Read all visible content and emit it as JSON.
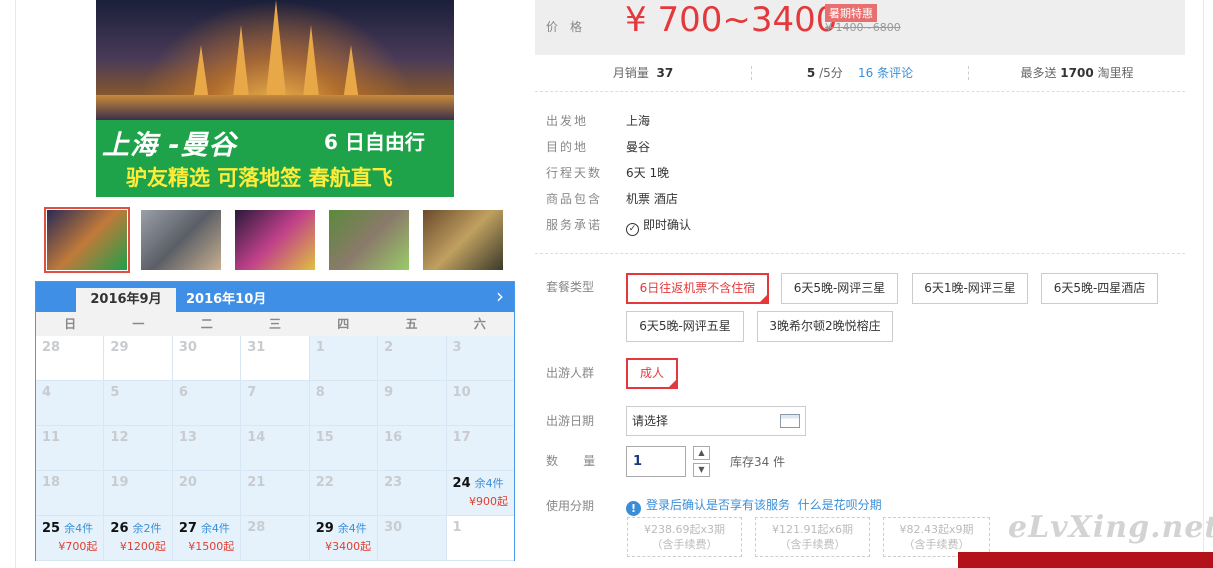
{
  "banner": {
    "title": "上海 -曼谷",
    "subtitle": "6 日自由行",
    "tagline": "驴友精选 可落地签 春航直飞"
  },
  "thumbnails": [
    {
      "name": "temple",
      "colors": [
        "#2a2a55",
        "#c07a3a",
        "#1f9f4a"
      ]
    },
    {
      "name": "dragon-statue",
      "colors": [
        "#9aa0a8",
        "#5b5e66",
        "#c8b090"
      ]
    },
    {
      "name": "night-street",
      "colors": [
        "#2a1a3a",
        "#c0408a",
        "#e0c040"
      ]
    },
    {
      "name": "elephants",
      "colors": [
        "#5a8a3a",
        "#8a7a6a",
        "#9acb6a"
      ]
    },
    {
      "name": "floating-market",
      "colors": [
        "#6a4a2a",
        "#c0a060",
        "#3a3a2a"
      ]
    }
  ],
  "calendar": {
    "tab_active": "2016年9月",
    "tab_next": "2016年10月",
    "next_arrow": "›",
    "weekdays": [
      "日",
      "一",
      "二",
      "三",
      "四",
      "五",
      "六"
    ],
    "rows": [
      [
        {
          "d": "28",
          "w": true
        },
        {
          "d": "29",
          "w": true
        },
        {
          "d": "30",
          "w": true
        },
        {
          "d": "31",
          "w": true
        },
        {
          "d": "1"
        },
        {
          "d": "2"
        },
        {
          "d": "3"
        }
      ],
      [
        {
          "d": "4"
        },
        {
          "d": "5"
        },
        {
          "d": "6"
        },
        {
          "d": "7"
        },
        {
          "d": "8"
        },
        {
          "d": "9"
        },
        {
          "d": "10"
        }
      ],
      [
        {
          "d": "11"
        },
        {
          "d": "12"
        },
        {
          "d": "13"
        },
        {
          "d": "14"
        },
        {
          "d": "15"
        },
        {
          "d": "16"
        },
        {
          "d": "17"
        }
      ],
      [
        {
          "d": "18"
        },
        {
          "d": "19"
        },
        {
          "d": "20"
        },
        {
          "d": "21"
        },
        {
          "d": "22"
        },
        {
          "d": "23"
        },
        {
          "d": "24",
          "stock": "余4件",
          "price": "¥900起"
        }
      ],
      [
        {
          "d": "25",
          "stock": "余4件",
          "price": "¥700起"
        },
        {
          "d": "26",
          "stock": "余2件",
          "price": "¥1200起"
        },
        {
          "d": "27",
          "stock": "余4件",
          "price": "¥1500起"
        },
        {
          "d": "28"
        },
        {
          "d": "29",
          "stock": "余4件",
          "price": "¥3400起"
        },
        {
          "d": "30"
        },
        {
          "d": "1",
          "w": true
        }
      ]
    ]
  },
  "price": {
    "label": "价格",
    "value": "¥ 700~3400",
    "badge": "暑期特惠",
    "old": "¥ 1400~6800"
  },
  "stats": {
    "monthly_sales_label": "月销量",
    "monthly_sales": "37",
    "rating": "5",
    "rating_suffix": "/5分",
    "reviews": "16 条评论",
    "points_prefix": "最多送",
    "points": "1700",
    "points_suffix": "淘里程"
  },
  "info": [
    {
      "label": "出发地",
      "value": "上海"
    },
    {
      "label": "目的地",
      "value": "曼谷"
    },
    {
      "label": "行程天数",
      "value": "6天 1晚"
    },
    {
      "label": "商品包含",
      "value": "机票   酒店"
    },
    {
      "label": "服务承诺",
      "value": "即时确认"
    }
  ],
  "package": {
    "label": "套餐类型",
    "options": [
      "6日往返机票不含住宿",
      "6天5晚-网评三星",
      "6天1晚-网评三星",
      "6天5晚-四星酒店",
      "6天5晚-网评五星",
      "3晚希尔顿2晚悦榕庄"
    ]
  },
  "group": {
    "label": "出游人群",
    "option": "成人"
  },
  "date": {
    "label": "出游日期",
    "placeholder": "请选择"
  },
  "quantity": {
    "label": "数    量",
    "value": "1",
    "stock": "库存34 件",
    "up": "▲",
    "down": "▼"
  },
  "installment": {
    "label": "使用分期",
    "note": "登录后确认是否享有该服务",
    "link": "什么是花呗分期",
    "plans": [
      {
        "line1": "¥238.69起x3期",
        "line2": "（含手续费）"
      },
      {
        "line1": "¥121.91起x6期",
        "line2": "（含手续费）"
      },
      {
        "line1": "¥82.43起x9期",
        "line2": "（含手续费）"
      }
    ]
  },
  "watermark": "eLvXing.net"
}
